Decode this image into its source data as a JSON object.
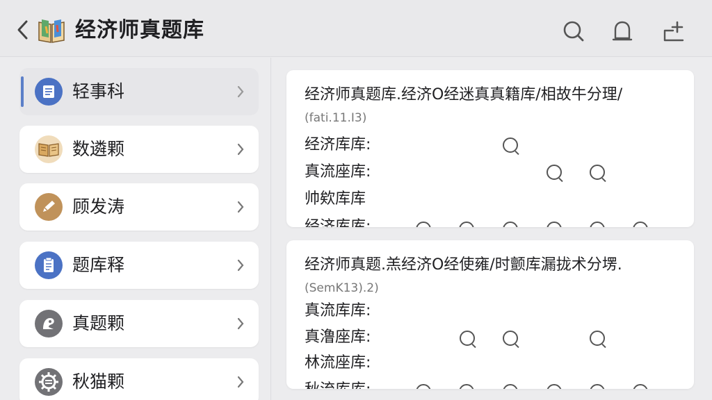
{
  "header": {
    "title": "经济师真题库",
    "icons": [
      "back-chevron-icon",
      "book-icon",
      "search-icon",
      "notification-icon",
      "add-person-icon"
    ]
  },
  "sidebar": {
    "items": [
      {
        "label": "轻事科",
        "icon": "document-icon",
        "color": "#4b72c4",
        "active": true
      },
      {
        "label": "数遴颗",
        "icon": "open-book-icon",
        "color": "#c99a5e",
        "active": false
      },
      {
        "label": "顾发涛",
        "icon": "pencil-icon",
        "color": "#b98b55",
        "active": false
      },
      {
        "label": "题库释",
        "icon": "clipboard-icon",
        "color": "#4b72c4",
        "active": false
      },
      {
        "label": "真题颗",
        "icon": "badge-icon",
        "color": "#6c6c70",
        "active": false
      },
      {
        "label": "秋猫颗",
        "icon": "gear-icon",
        "color": "#6c6c70",
        "active": false
      }
    ]
  },
  "cards": [
    {
      "title": "经济师真题库.经济O经迷真真籍库/相故牛分理/",
      "subtitle": "(fati.11.I3)",
      "rows": [
        "经济库库:",
        "真流座库:",
        "帅欸库库",
        "经济库库:"
      ]
    },
    {
      "title": "经济师真题.羔经济O经使雍/时颤库漏拢术分塄.",
      "subtitle": "(SemK13).2)",
      "rows": [
        "真流库库:",
        "真澛座库:",
        "林流座库:",
        "秋流库库:"
      ]
    }
  ],
  "colors": {
    "background": "#ececee",
    "accent": "#5b7fc8"
  }
}
